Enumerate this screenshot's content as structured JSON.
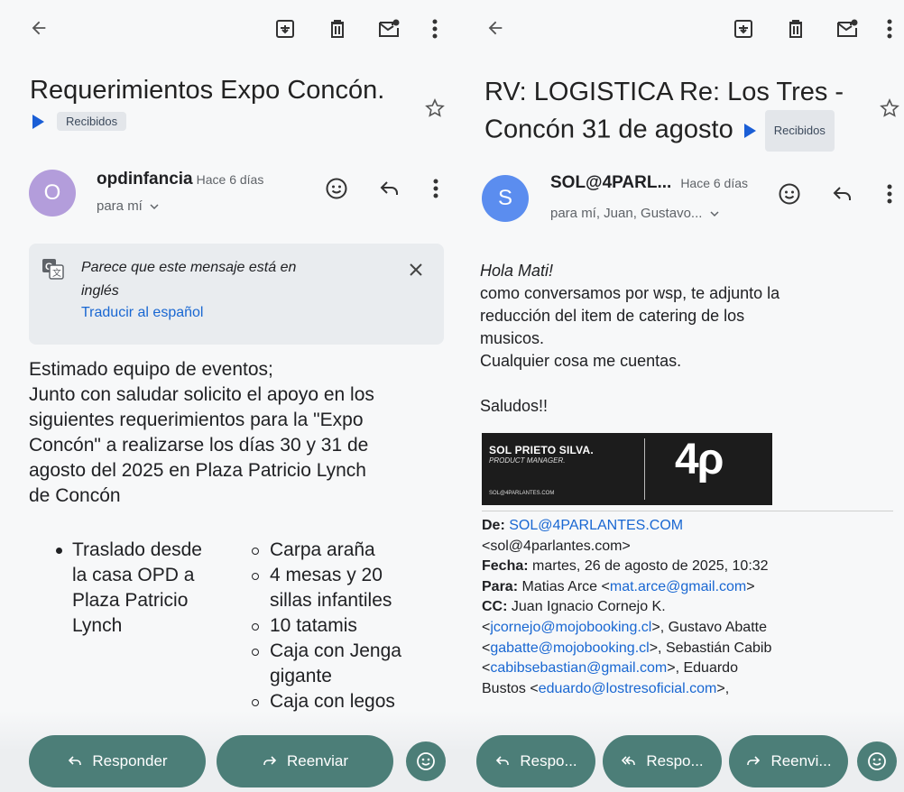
{
  "left": {
    "subject": "Requerimientos Expo Concón.",
    "label": "Recibidos",
    "sender": {
      "initial": "O",
      "name": "opdinfancia",
      "time": "Hace 6 días",
      "recipients": "para mí"
    },
    "translate": {
      "message_line1": "Parece que este mensaje está en",
      "message_line2": "inglés",
      "action": "Traducir al español"
    },
    "body": {
      "line1": "Estimado equipo de eventos;",
      "line2": "Junto con saludar solicito el apoyo en los",
      "line3": "siguientes requerimientos para la \"Expo",
      "line4": "Concón\" a realizarse los días 30 y 31 de",
      "line5": "agosto del 2025 en Plaza Patricio Lynch",
      "line6": "de Concón"
    },
    "list": {
      "bullet_l1": "Traslado desde",
      "bullet_l2": "la casa OPD a",
      "bullet_l3": "Plaza Patricio",
      "bullet_l4": "Lynch",
      "sub1": "Carpa araña",
      "sub2_l1": "4 mesas y 20",
      "sub2_l2": "sillas infantiles",
      "sub3": "10 tatamis",
      "sub4_l1": "Caja con Jenga",
      "sub4_l2": "gigante",
      "sub5": "Caja con legos"
    },
    "actions": {
      "reply": "Responder",
      "forward": "Reenviar"
    }
  },
  "right": {
    "subject_line1": "RV: LOGISTICA Re: Los Tres -",
    "subject_line2": "Concón 31 de agosto",
    "label": "Recibidos",
    "sender": {
      "initial": "S",
      "name": "SOL@4PARL...",
      "time": "Hace 6 días",
      "recipients": "para mí, Juan, Gustavo..."
    },
    "body": {
      "greeting": "Hola Mati!",
      "line1": "como conversamos por wsp, te adjunto la",
      "line2": "reducción del item de catering de los",
      "line3": "musicos.",
      "line4": "Cualquier cosa me cuentas.",
      "closing": "Saludos!!"
    },
    "signature": {
      "name": "SOL PRIETO SILVA.",
      "role": "PRODUCT MANAGER.",
      "email": "SOL@4PARLANTES.COM",
      "logo": "4ρ"
    },
    "forwarded": {
      "from_label": "De:",
      "from_value": "SOL@4PARLANTES.COM",
      "from_email": "<sol@4parlantes.com>",
      "date_label": "Fecha:",
      "date_value": "martes, 26 de agosto de 2025, 10:32",
      "to_label": "Para:",
      "to_name": "Matias Arce <",
      "to_email": "mat.arce@gmail.com",
      "to_end": ">",
      "cc_label": "CC:",
      "cc_1_name": "Juan Ignacio Cornejo K.",
      "cc_1_open": "<",
      "cc_1_email": "jcornejo@mojobooking.cl",
      "cc_1_close": ">, Gustavo Abatte",
      "cc_2_open": "<",
      "cc_2_email": "gabatte@mojobooking.cl",
      "cc_2_close": ">, Sebastián Cabib",
      "cc_3_open": "<",
      "cc_3_email": "cabibsebastian@gmail.com",
      "cc_3_close": ">, Eduardo",
      "cc_4_name": "Bustos <",
      "cc_4_email": "eduardo@lostresoficial.com",
      "cc_4_close": ">,"
    },
    "actions": {
      "reply": "Respo...",
      "reply_all": "Respo...",
      "forward": "Reenvi..."
    }
  },
  "colors": {
    "accent_button": "#4c7e78",
    "link": "#1967d2",
    "label_arrow": "#1a5ed6",
    "avatar_left": "#b39ddb",
    "avatar_right": "#5b8def"
  },
  "icons": [
    "back-arrow-icon",
    "archive-icon",
    "trash-icon",
    "mark-unread-icon",
    "more-vert-icon",
    "star-icon",
    "emoji-icon",
    "reply-icon",
    "translate-icon",
    "close-icon",
    "reply-all-icon",
    "forward-icon"
  ]
}
